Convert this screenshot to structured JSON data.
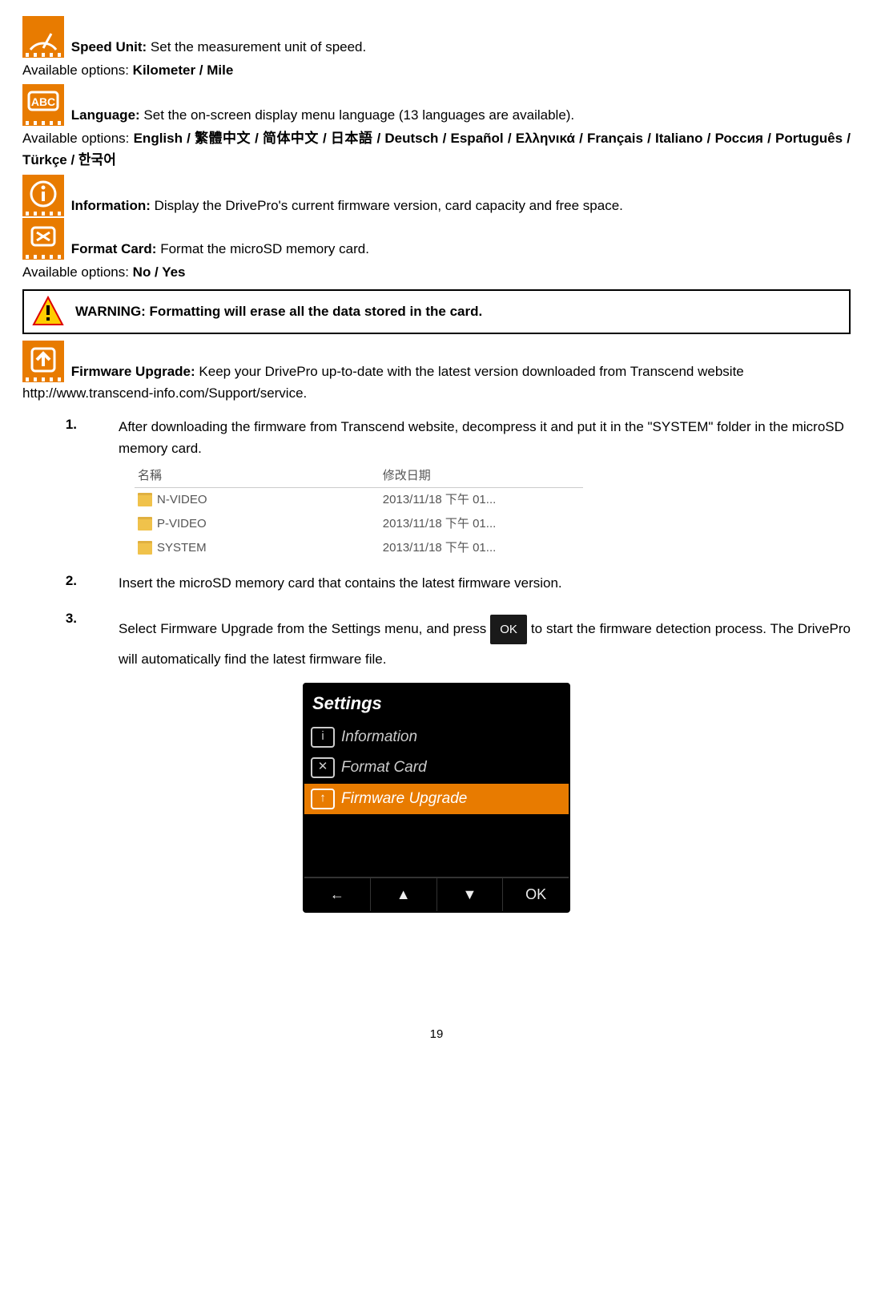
{
  "speed": {
    "label": "Speed Unit:",
    "desc": " Set the measurement unit of speed.",
    "avail_label": "Available options: ",
    "avail": "Kilometer / Mile"
  },
  "lang": {
    "label": "Language:",
    "desc": " Set the on-screen display menu language (13 languages are available).",
    "avail_label": "Available options:   ",
    "avail": "English / 繁體中文 / 简体中文 / 日本語 / Deutsch / Español / Ελληνικά / Français / Italiano / Россия / Português / Türkçe / 한국어"
  },
  "info": {
    "label": "Information:",
    "desc": " Display the DrivePro's current firmware version, card capacity and free space."
  },
  "format": {
    "label": "Format Card:",
    "desc": " Format the microSD memory card.",
    "avail_label": "Available options: ",
    "avail": "No / Yes"
  },
  "warning": "WARNING: Formatting will erase all the data stored in the card.",
  "fw": {
    "label": "Firmware Upgrade:",
    "desc": " Keep your DrivePro up-to-date with the latest version downloaded from Transcend website http://www.transcend-info.com/Support/service."
  },
  "steps": {
    "s1": "After downloading the firmware from Transcend website, decompress it and put it in the \"SYSTEM\" folder in the microSD memory card.",
    "s2": "Insert the microSD memory card that contains the latest firmware version.",
    "s3a": "Select Firmware Upgrade from the Settings menu, and press ",
    "s3b": " to start the firmware detection process. The DrivePro will automatically find the latest firmware file."
  },
  "filewin": {
    "hdr_name": "名稱",
    "hdr_date": "修改日期",
    "rows": [
      {
        "name": "N-VIDEO",
        "date": "2013/11/18 下午 01..."
      },
      {
        "name": "P-VIDEO",
        "date": "2013/11/18 下午 01..."
      },
      {
        "name": "SYSTEM",
        "date": "2013/11/18 下午 01..."
      }
    ]
  },
  "device": {
    "title": "Settings",
    "items": [
      "Information",
      "Format Card",
      "Firmware Upgrade"
    ],
    "nav_back": "←",
    "nav_up": "▲",
    "nav_down": "▼",
    "nav_ok": "OK"
  },
  "ok_btn": "OK",
  "page": "19"
}
